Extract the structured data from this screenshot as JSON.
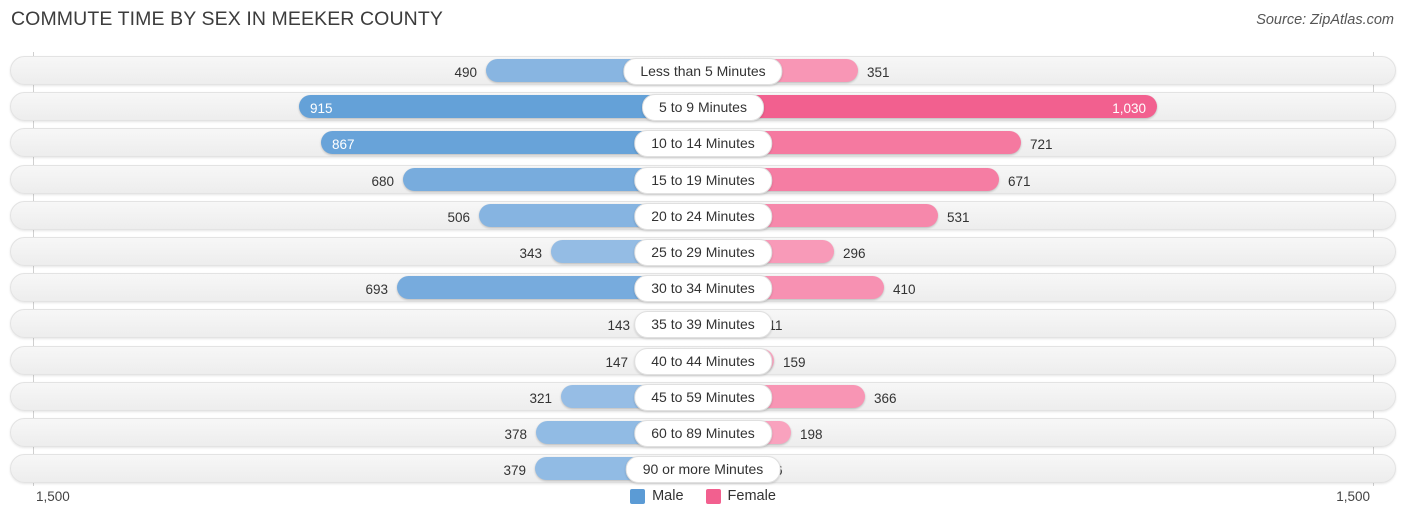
{
  "header": {
    "title": "COMMUTE TIME BY SEX IN MEEKER COUNTY",
    "source": "Source: ZipAtlas.com"
  },
  "axis": {
    "left_tick": "1,500",
    "right_tick": "1,500"
  },
  "legend": {
    "items": [
      {
        "label": "Male",
        "color": "#5b9bd5"
      },
      {
        "label": "Female",
        "color": "#f2608f"
      }
    ]
  },
  "chart_data": {
    "type": "bar",
    "title": "COMMUTE TIME BY SEX IN MEEKER COUNTY",
    "subtitle": "Source: ZipAtlas.com",
    "orientation": "horizontal-diverging",
    "xlabel": "",
    "ylabel": "",
    "xlim": [
      -1500,
      1500
    ],
    "axis_max": 1500,
    "grid": false,
    "legend_position": "bottom-center",
    "categories": [
      "Less than 5 Minutes",
      "5 to 9 Minutes",
      "10 to 14 Minutes",
      "15 to 19 Minutes",
      "20 to 24 Minutes",
      "25 to 29 Minutes",
      "30 to 34 Minutes",
      "35 to 39 Minutes",
      "40 to 44 Minutes",
      "45 to 59 Minutes",
      "60 to 89 Minutes",
      "90 or more Minutes"
    ],
    "series": [
      {
        "name": "Male",
        "color": "#5b9bd5",
        "side": "left",
        "values": [
          490,
          915,
          867,
          680,
          506,
          343,
          693,
          143,
          147,
          321,
          378,
          379
        ],
        "labels": [
          "490",
          "915",
          "867",
          "680",
          "506",
          "343",
          "693",
          "143",
          "147",
          "321",
          "378",
          "379"
        ]
      },
      {
        "name": "Female",
        "color": "#f2608f",
        "side": "right",
        "values": [
          351,
          1030,
          721,
          671,
          531,
          296,
          410,
          111,
          159,
          366,
          198,
          106
        ],
        "labels": [
          "351",
          "1,030",
          "721",
          "671",
          "531",
          "296",
          "410",
          "111",
          "159",
          "366",
          "198",
          "106"
        ]
      }
    ]
  }
}
